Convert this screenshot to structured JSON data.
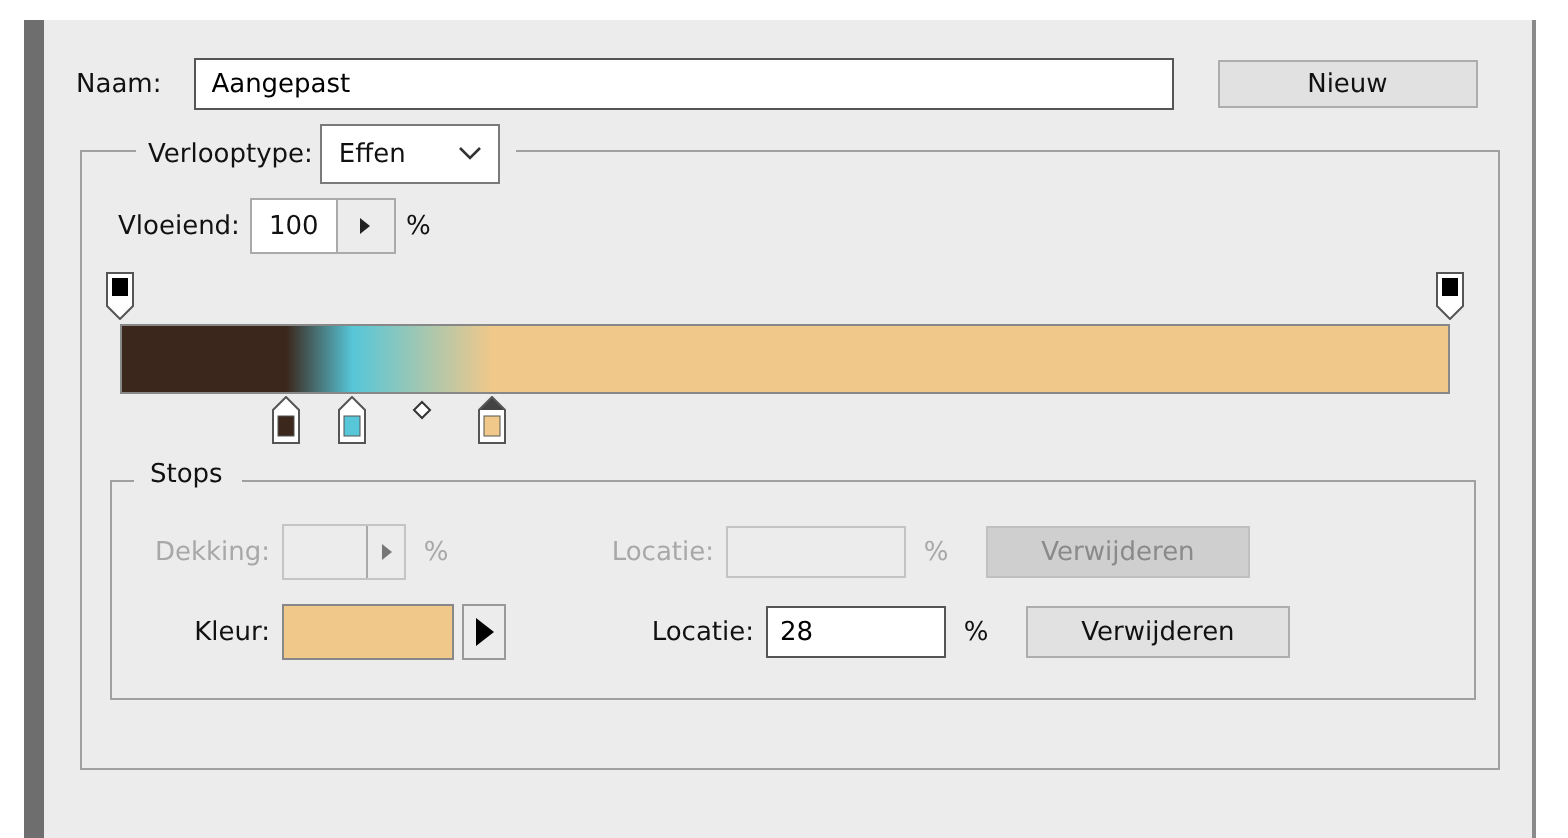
{
  "name": {
    "label": "Naam:",
    "value": "Aangepast"
  },
  "new_button": {
    "label": "Nieuw"
  },
  "gradient_type": {
    "label": "Verlooptype:",
    "value": "Effen"
  },
  "smoothness": {
    "label": "Vloeiend:",
    "value": "100",
    "unit": "%"
  },
  "opacity_stops": [
    {
      "level": 0,
      "selected": false
    },
    {
      "level": 1,
      "selected": false
    }
  ],
  "color_stops": [
    {
      "color": "#3b271c",
      "level": 0.125,
      "selected": false
    },
    {
      "color": "#56c6d8",
      "level": 0.175,
      "selected": false
    },
    {
      "color": "#f0c88a",
      "level": 0.28,
      "selected": true
    }
  ],
  "stops": {
    "title": "Stops",
    "opacity": {
      "label": "Dekking:",
      "unit": "%",
      "disabled": true
    },
    "opacity_location": {
      "label": "Locatie:",
      "unit": "%",
      "disabled": true
    },
    "opacity_delete": {
      "label": "Verwijderen",
      "disabled": true
    },
    "color": {
      "label": "Kleur:"
    },
    "color_location": {
      "label": "Locatie:",
      "value": "28",
      "unit": "%"
    },
    "color_delete": {
      "label": "Verwijderen",
      "disabled": false
    }
  }
}
